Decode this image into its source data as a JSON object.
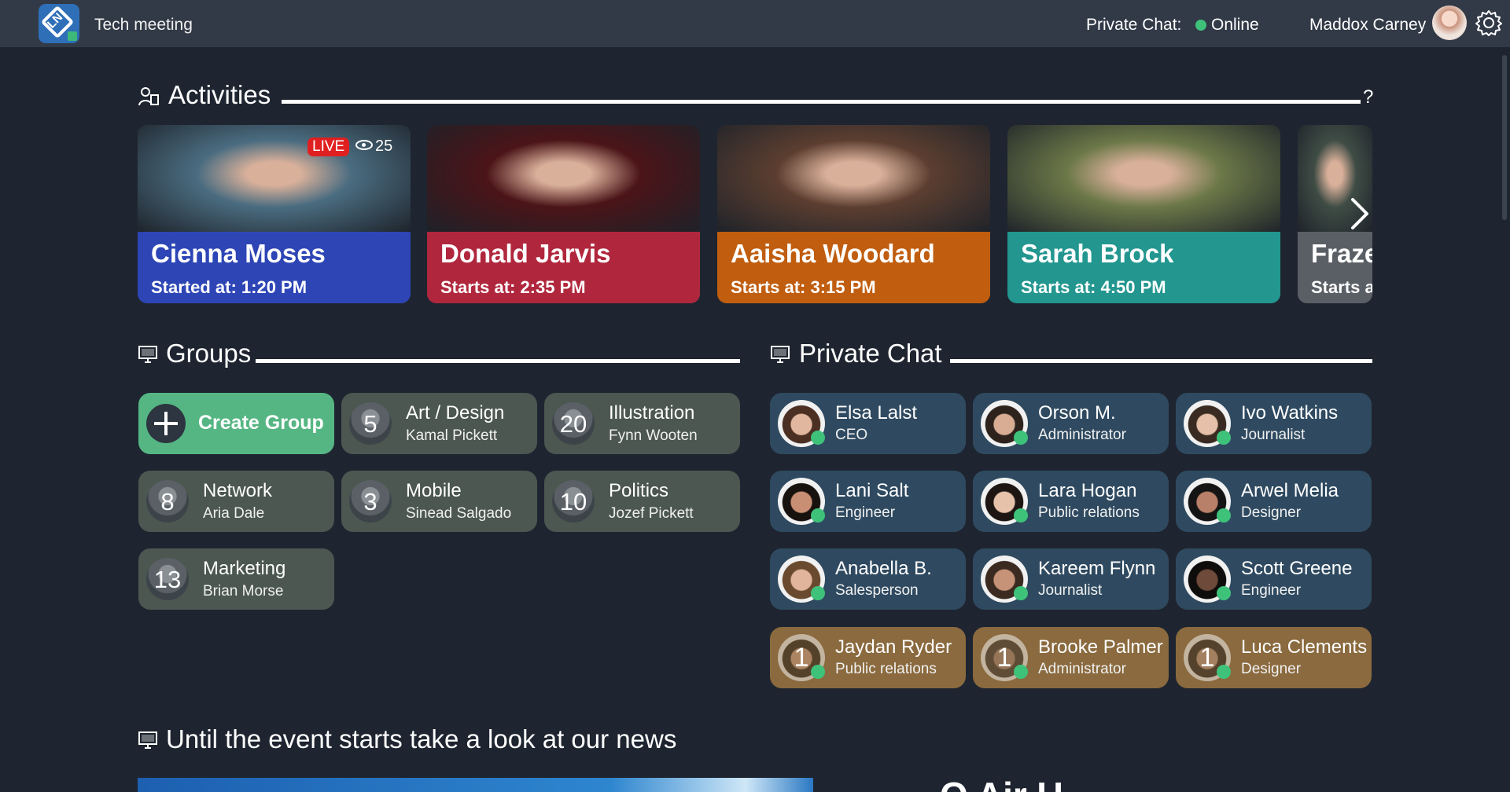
{
  "topbar": {
    "title": "Tech meeting",
    "private_chat_label": "Private Chat:",
    "status": "Online",
    "user_name": "Maddox Carney"
  },
  "sections": {
    "activities": "Activities",
    "groups": "Groups",
    "private_chat": "Private Chat",
    "news": "Until the event starts take a look at our news",
    "help": "?"
  },
  "activities": [
    {
      "name": "Cienna Moses",
      "time": "Started at: 1:20 PM",
      "live_label": "LIVE",
      "viewers": "25",
      "band_color": "#2f49c4",
      "photo_color": "#4a6c80"
    },
    {
      "name": "Donald Jarvis",
      "time": "Starts at: 2:35 PM",
      "band_color": "#c0283f",
      "photo_color": "#4b1418"
    },
    {
      "name": "Aaisha Woodard",
      "time": "Starts at: 3:15 PM",
      "band_color": "#d2640c",
      "photo_color": "#5c3e30"
    },
    {
      "name": "Sarah Brock",
      "time": "Starts at: 4:50 PM",
      "band_color": "#22a39a",
      "photo_color": "#6c7848"
    },
    {
      "name": "Fraze",
      "time": "Starts a",
      "band_color": "#5f666c",
      "photo_color": "#3f4c45"
    }
  ],
  "groups": {
    "create_label": "Create Group",
    "items": [
      {
        "count": "5",
        "title": "Art / Design",
        "sub": "Kamal Pickett"
      },
      {
        "count": "20",
        "title": "Illustration",
        "sub": "Fynn Wooten"
      },
      {
        "count": "8",
        "title": "Network",
        "sub": "Aria Dale"
      },
      {
        "count": "3",
        "title": "Mobile",
        "sub": "Sinead Salgado"
      },
      {
        "count": "10",
        "title": "Politics",
        "sub": "Jozef Pickett"
      },
      {
        "count": "13",
        "title": "Marketing",
        "sub": "Brian Morse"
      }
    ]
  },
  "private_chat": [
    {
      "name": "Elsa Lalst",
      "role": "CEO",
      "unread": ""
    },
    {
      "name": "Orson M.",
      "role": "Administrator",
      "unread": ""
    },
    {
      "name": "Ivo Watkins",
      "role": "Journalist",
      "unread": ""
    },
    {
      "name": "Lani Salt",
      "role": "Engineer",
      "unread": ""
    },
    {
      "name": "Lara Hogan",
      "role": "Public relations",
      "unread": ""
    },
    {
      "name": "Arwel Melia",
      "role": "Designer",
      "unread": ""
    },
    {
      "name": "Anabella B.",
      "role": "Salesperson",
      "unread": ""
    },
    {
      "name": "Kareem Flynn",
      "role": "Journalist",
      "unread": ""
    },
    {
      "name": "Scott Greene",
      "role": "Engineer",
      "unread": ""
    },
    {
      "name": "Jaydan Ryder",
      "role": "Public relations",
      "unread": "1"
    },
    {
      "name": "Brooke Palmer",
      "role": "Administrator",
      "unread": "1"
    },
    {
      "name": "Luca Clements",
      "role": "Designer",
      "unread": "1"
    }
  ],
  "news": {
    "heading_partial": "Q Air U"
  },
  "colors": {
    "background": "#1e2530",
    "topbar": "#323a47",
    "online": "#3ec27a",
    "create_group": "#55b683",
    "group_card": "#4b5750",
    "chat_card": "#2f4a60",
    "chat_card_unread": "#8a6a3e"
  }
}
